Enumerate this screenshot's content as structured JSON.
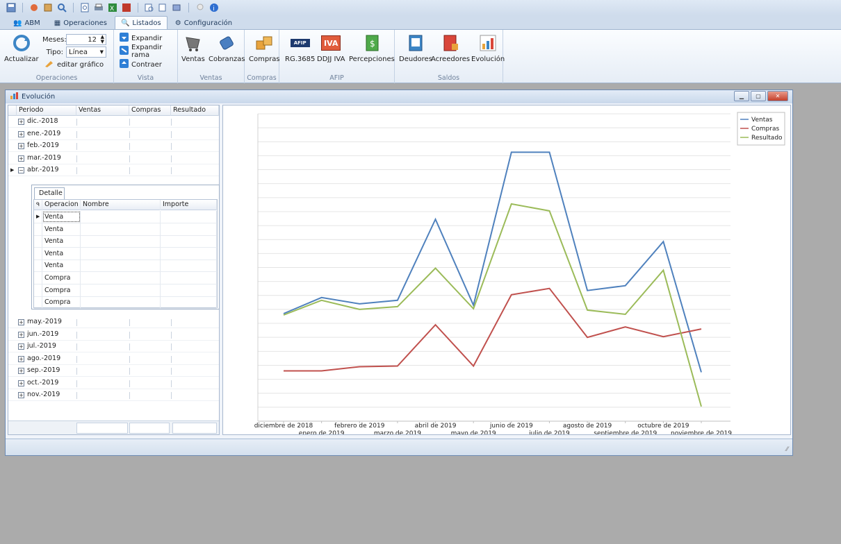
{
  "ribbon_tabs": [
    "ABM",
    "Operaciones",
    "Listados",
    "Configuración"
  ],
  "ribbon": {
    "operaciones": {
      "actualizar": "Actualizar",
      "meses_label": "Meses:",
      "meses_value": "12",
      "tipo_label": "Tipo:",
      "tipo_value": "Línea",
      "editar": "editar gráfico",
      "group": "Operaciones"
    },
    "vista": {
      "expandir": "Expandir",
      "expandir_rama": "Expandir rama",
      "contraer": "Contraer",
      "group": "Vista"
    },
    "ventas": {
      "ventas": "Ventas",
      "cobranzas": "Cobranzas",
      "group": "Ventas"
    },
    "compras": {
      "compras": "Compras",
      "group": "Compras"
    },
    "afip": {
      "rg": "RG.3685",
      "ddjj": "DDJJ IVA",
      "percepciones": "Percepciones",
      "group": "AFIP",
      "iva_icon_text": "IVA",
      "afip_icon_text": "AFIP"
    },
    "saldos": {
      "deudores": "Deudores",
      "acreedores": "Acreedores",
      "evolucion": "Evolución",
      "group": "Saldos"
    }
  },
  "window": {
    "title": "Evolución"
  },
  "grid": {
    "headers": [
      "Periodo",
      "Ventas",
      "Compras",
      "Resultado"
    ],
    "rows_top": [
      "dic.-2018",
      "ene.-2019",
      "feb.-2019",
      "mar.-2019",
      "abr.-2019"
    ],
    "rows_bottom": [
      "may.-2019",
      "jun.-2019",
      "jul.-2019",
      "ago.-2019",
      "sep.-2019",
      "oct.-2019",
      "nov.-2019"
    ],
    "expanded_marker": "⊟",
    "collapsed_marker": "⊞"
  },
  "detail": {
    "tab": "Detalle",
    "headers": [
      "Operacion",
      "Nombre",
      "Importe"
    ],
    "rows": [
      "Venta",
      "Venta",
      "Venta",
      "Venta",
      "Venta",
      "Compra",
      "Compra",
      "Compra"
    ]
  },
  "chart_data": {
    "type": "line",
    "categories": [
      "diciembre de 2018",
      "enero de 2019",
      "febrero de 2019",
      "marzo de 2019",
      "abril de 2019",
      "mayo de 2019",
      "junio de 2019",
      "julio de 2019",
      "agosto de 2019",
      "septiembre de 2019",
      "octubre de 2019",
      "noviembre de 2019"
    ],
    "series": [
      {
        "name": "Ventas",
        "color": "#4f81bd",
        "values": [
          34,
          57,
          48,
          53,
          169,
          46,
          265,
          265,
          67,
          74,
          137,
          -50
        ]
      },
      {
        "name": "Compras",
        "color": "#c0504d",
        "values": [
          -48,
          -48,
          -42,
          -41,
          18,
          -41,
          61,
          70,
          0,
          15,
          1,
          12
        ]
      },
      {
        "name": "Resultado",
        "color": "#9bbb59",
        "values": [
          32,
          53,
          40,
          44,
          99,
          41,
          191,
          181,
          39,
          33,
          96,
          -99
        ]
      }
    ],
    "ylim": [
      -120,
      320
    ],
    "grid": "horizontal",
    "legend": "top-right"
  }
}
